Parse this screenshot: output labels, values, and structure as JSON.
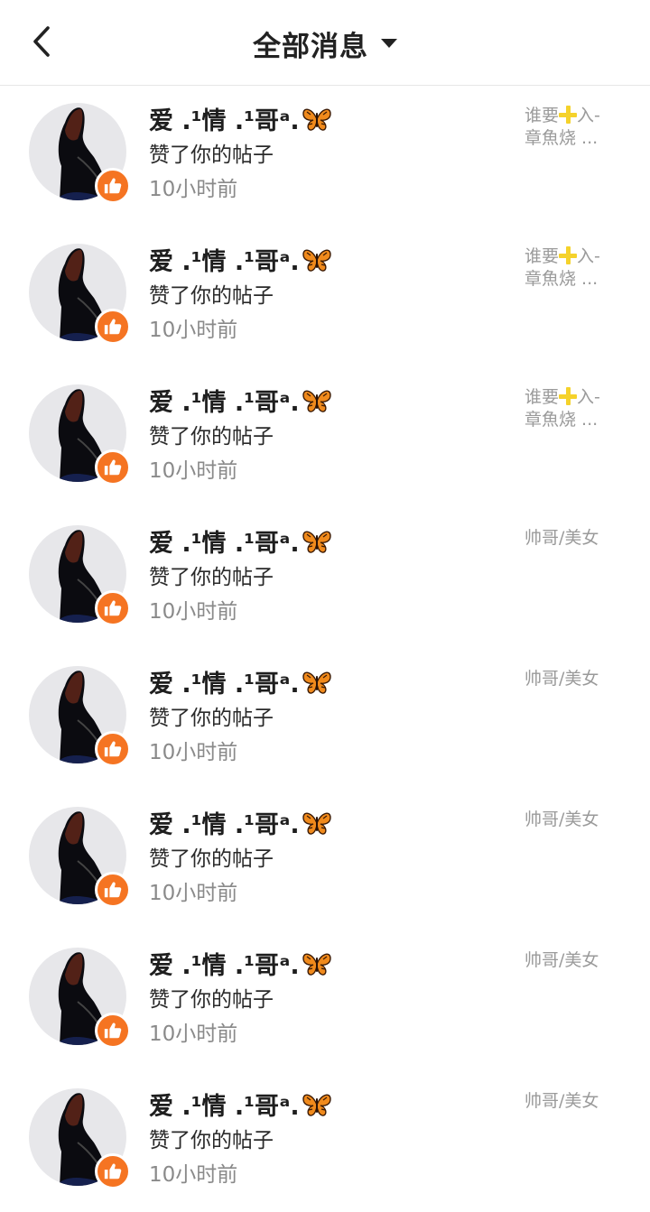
{
  "header": {
    "title": "全部消息"
  },
  "notifications": [
    {
      "name": "爱 .¹情 .¹哥ᵃ.",
      "action": "赞了你的帖子",
      "time": "10小时前",
      "post_line1_a": "谁要",
      "post_line1_b": "入-",
      "post_line2": "章魚烧 ...",
      "has_plus": true
    },
    {
      "name": "爱 .¹情 .¹哥ᵃ.",
      "action": "赞了你的帖子",
      "time": "10小时前",
      "post_line1_a": "谁要",
      "post_line1_b": "入-",
      "post_line2": "章魚烧 ...",
      "has_plus": true
    },
    {
      "name": "爱 .¹情 .¹哥ᵃ.",
      "action": "赞了你的帖子",
      "time": "10小时前",
      "post_line1_a": "谁要",
      "post_line1_b": "入-",
      "post_line2": "章魚烧 ...",
      "has_plus": true
    },
    {
      "name": "爱 .¹情 .¹哥ᵃ.",
      "action": "赞了你的帖子",
      "time": "10小时前",
      "post_line1_a": "帅哥/美女",
      "post_line1_b": "",
      "post_line2": "",
      "has_plus": false
    },
    {
      "name": "爱 .¹情 .¹哥ᵃ.",
      "action": "赞了你的帖子",
      "time": "10小时前",
      "post_line1_a": "帅哥/美女",
      "post_line1_b": "",
      "post_line2": "",
      "has_plus": false
    },
    {
      "name": "爱 .¹情 .¹哥ᵃ.",
      "action": "赞了你的帖子",
      "time": "10小时前",
      "post_line1_a": "帅哥/美女",
      "post_line1_b": "",
      "post_line2": "",
      "has_plus": false
    },
    {
      "name": "爱 .¹情 .¹哥ᵃ.",
      "action": "赞了你的帖子",
      "time": "10小时前",
      "post_line1_a": "帅哥/美女",
      "post_line1_b": "",
      "post_line2": "",
      "has_plus": false
    },
    {
      "name": "爱 .¹情 .¹哥ᵃ.",
      "action": "赞了你的帖子",
      "time": "10小时前",
      "post_line1_a": "帅哥/美女",
      "post_line1_b": "",
      "post_line2": "",
      "has_plus": false
    }
  ],
  "icons": {
    "back": "chevron-left-icon",
    "dropdown": "caret-down-icon",
    "like": "thumbs-up-icon",
    "name_emoji": "butterfly-icon"
  },
  "colors": {
    "like_badge": "#f57422",
    "plus_emoji": "#f5d22b",
    "butterfly": "#f08a1c"
  }
}
